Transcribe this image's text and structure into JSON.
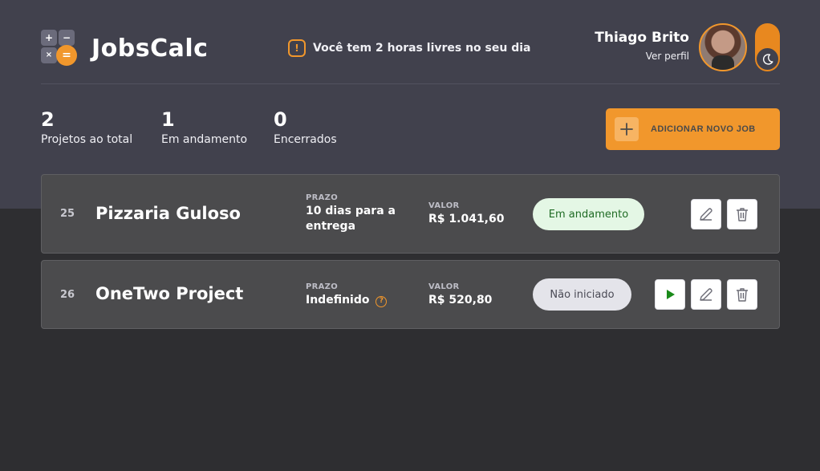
{
  "app": {
    "title": "JobsCalc"
  },
  "logo": {
    "keys": [
      "+",
      "−",
      "×",
      "="
    ]
  },
  "header": {
    "notice": "Você tem 2 horas livres no seu dia",
    "notice_icon": "alert-icon",
    "profile_name": "Thiago Brito",
    "profile_link": "Ver perfil",
    "theme_toggle_icon": "moon-icon"
  },
  "summary": {
    "total": {
      "value": "2",
      "label": "Projetos ao total"
    },
    "in_progress": {
      "value": "1",
      "label": "Em andamento"
    },
    "closed": {
      "value": "0",
      "label": "Encerrados"
    },
    "add_button": "ADICIONAR NOVO JOB"
  },
  "jobs": [
    {
      "id": "25",
      "name": "Pizzaria Guloso",
      "deadline_label": "PRAZO",
      "deadline_value": "10 dias para a entrega",
      "value_label": "VALOR",
      "value": "R$ 1.041,60",
      "status": "Em andamento"
    },
    {
      "id": "26",
      "name": "OneTwo Project",
      "deadline_label": "PRAZO",
      "deadline_value": "Indefinido",
      "value_label": "VALOR",
      "value": "R$ 520,80",
      "status": "Não iniciado",
      "help_icon_text": "?"
    }
  ],
  "colors": {
    "accent": "#f1972c",
    "header_bg": "#41414d",
    "page_bg": "#2e2e31",
    "card_bg": "#4b4b4d",
    "status_active_bg": "#e4f7e5",
    "status_idle_bg": "#e4e4ea",
    "play_green": "#1a8a1a"
  }
}
